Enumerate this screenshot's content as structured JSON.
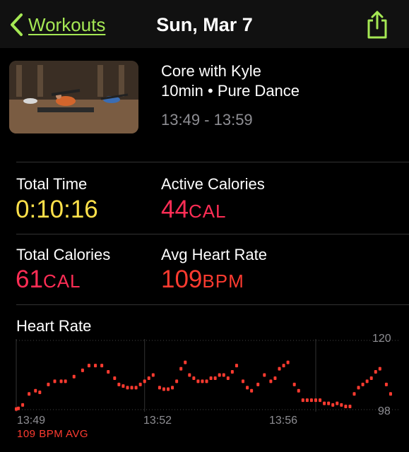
{
  "nav": {
    "back_label": "Workouts",
    "title": "Sun, Mar 7"
  },
  "workout": {
    "title": "Core with Kyle",
    "subtitle": "10min • Pure Dance",
    "time_range": "13:49 - 13:59"
  },
  "stats": {
    "total_time": {
      "label": "Total Time",
      "value": "0:10:16",
      "color": "#ffe14a"
    },
    "active_calories": {
      "label": "Active Calories",
      "value": "44",
      "unit": "CAL",
      "color": "#ff2d55"
    },
    "total_calories": {
      "label": "Total Calories",
      "value": "61",
      "unit": "CAL",
      "color": "#ff2d55"
    },
    "avg_heart_rate": {
      "label": "Avg Heart Rate",
      "value": "109",
      "unit": "BPM",
      "color": "#ff3b30"
    }
  },
  "heart_rate": {
    "title": "Heart Rate",
    "avg_label": "109 BPM AVG",
    "y_max_label": "120",
    "y_min_label": "98",
    "x_labels": [
      "13:49",
      "13:52",
      "13:56"
    ]
  },
  "chart_data": {
    "type": "scatter",
    "xlabel": "",
    "ylabel": "",
    "ylim": [
      98,
      120
    ],
    "x_ticks": [
      "13:49",
      "13:52",
      "13:56"
    ],
    "series": [
      {
        "color": "#ff3b30",
        "points": [
          [
            0.0,
            98.2
          ],
          [
            0.05,
            98.4
          ],
          [
            0.15,
            99.5
          ],
          [
            0.3,
            103
          ],
          [
            0.45,
            104
          ],
          [
            0.55,
            103.5
          ],
          [
            0.75,
            106
          ],
          [
            0.9,
            107
          ],
          [
            1.05,
            107
          ],
          [
            1.15,
            107
          ],
          [
            1.35,
            108.5
          ],
          [
            1.55,
            110.5
          ],
          [
            1.7,
            112
          ],
          [
            1.85,
            112
          ],
          [
            2.0,
            112
          ],
          [
            2.15,
            110
          ],
          [
            2.3,
            108
          ],
          [
            2.4,
            106
          ],
          [
            2.5,
            105.5
          ],
          [
            2.6,
            105
          ],
          [
            2.7,
            105
          ],
          [
            2.8,
            105
          ],
          [
            2.9,
            106
          ],
          [
            3.0,
            107
          ],
          [
            3.1,
            108
          ],
          [
            3.2,
            109
          ],
          [
            3.35,
            105
          ],
          [
            3.45,
            104.5
          ],
          [
            3.55,
            104.5
          ],
          [
            3.65,
            105
          ],
          [
            3.75,
            107
          ],
          [
            3.85,
            111
          ],
          [
            3.95,
            113
          ],
          [
            4.05,
            109
          ],
          [
            4.15,
            108
          ],
          [
            4.25,
            107
          ],
          [
            4.35,
            107
          ],
          [
            4.45,
            107
          ],
          [
            4.55,
            108
          ],
          [
            4.65,
            108
          ],
          [
            4.75,
            109
          ],
          [
            4.85,
            109
          ],
          [
            4.95,
            108
          ],
          [
            5.05,
            110
          ],
          [
            5.15,
            112
          ],
          [
            5.3,
            107
          ],
          [
            5.4,
            105
          ],
          [
            5.5,
            104
          ],
          [
            5.65,
            106
          ],
          [
            5.8,
            109
          ],
          [
            5.95,
            107
          ],
          [
            6.05,
            108
          ],
          [
            6.15,
            111
          ],
          [
            6.25,
            112
          ],
          [
            6.35,
            113
          ],
          [
            6.5,
            106
          ],
          [
            6.6,
            104
          ],
          [
            6.7,
            101
          ],
          [
            6.8,
            101
          ],
          [
            6.9,
            101
          ],
          [
            7.0,
            101
          ],
          [
            7.1,
            101
          ],
          [
            7.2,
            100
          ],
          [
            7.3,
            100
          ],
          [
            7.4,
            99.5
          ],
          [
            7.5,
            100
          ],
          [
            7.6,
            99.5
          ],
          [
            7.7,
            99
          ],
          [
            7.8,
            99
          ],
          [
            7.9,
            103
          ],
          [
            8.0,
            105
          ],
          [
            8.1,
            106
          ],
          [
            8.2,
            107
          ],
          [
            8.3,
            108
          ],
          [
            8.4,
            110
          ],
          [
            8.5,
            111
          ],
          [
            8.65,
            106
          ],
          [
            8.75,
            103
          ]
        ]
      }
    ]
  }
}
